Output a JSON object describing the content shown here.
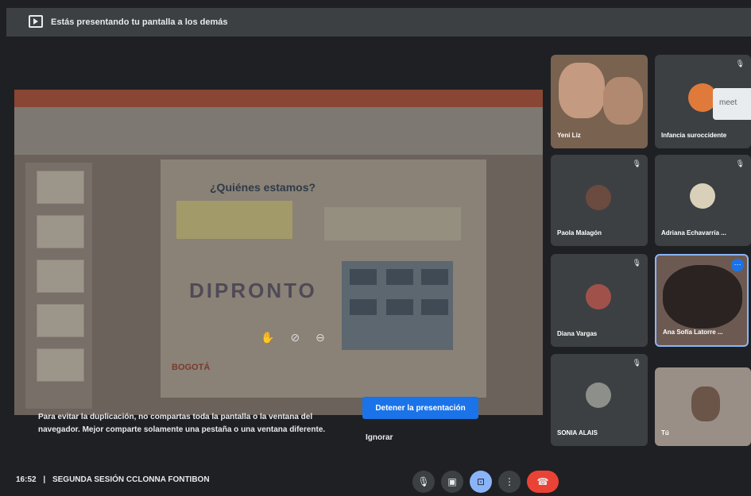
{
  "banner": {
    "text": "Estás presentando tu pantalla a los demás"
  },
  "shared_slide": {
    "title": "¿Quiénes estamos?",
    "logo_text": "DIPRONTO",
    "footer_logo": "BOGOTÁ"
  },
  "notice": {
    "text": "Para evitar la duplicación, no compartas toda la pantalla o la ventana del navegador. Mejor comparte solamente una pestaña o una ventana diferente."
  },
  "buttons": {
    "stop_presenting": "Detener la presentación",
    "ignore": "Ignorar"
  },
  "participants": [
    {
      "name": "Yeni Liz"
    },
    {
      "name": "Infancia suroccidente"
    },
    {
      "name": "Paola Malagón"
    },
    {
      "name": "Adriana Echavarría ..."
    },
    {
      "name": "Diana Vargas"
    },
    {
      "name": "Ana Sofía Latorre ..."
    },
    {
      "name": "SONIA ALAIS"
    },
    {
      "name": "Tú"
    }
  ],
  "meet_badge": "meet",
  "footer": {
    "time": "16:52",
    "separator": "|",
    "meeting_name": "SEGUNDA SESIÓN CCLONNA FONTIBON"
  },
  "controls": {
    "mic": "mic-icon",
    "camera": "camera-icon",
    "present": "present-icon",
    "more": "more-icon",
    "hangup": "hangup-icon"
  },
  "colors": {
    "accent": "#1a73e8",
    "hangup": "#ea4335",
    "tile": "#3c4043",
    "background": "#1f2023"
  }
}
